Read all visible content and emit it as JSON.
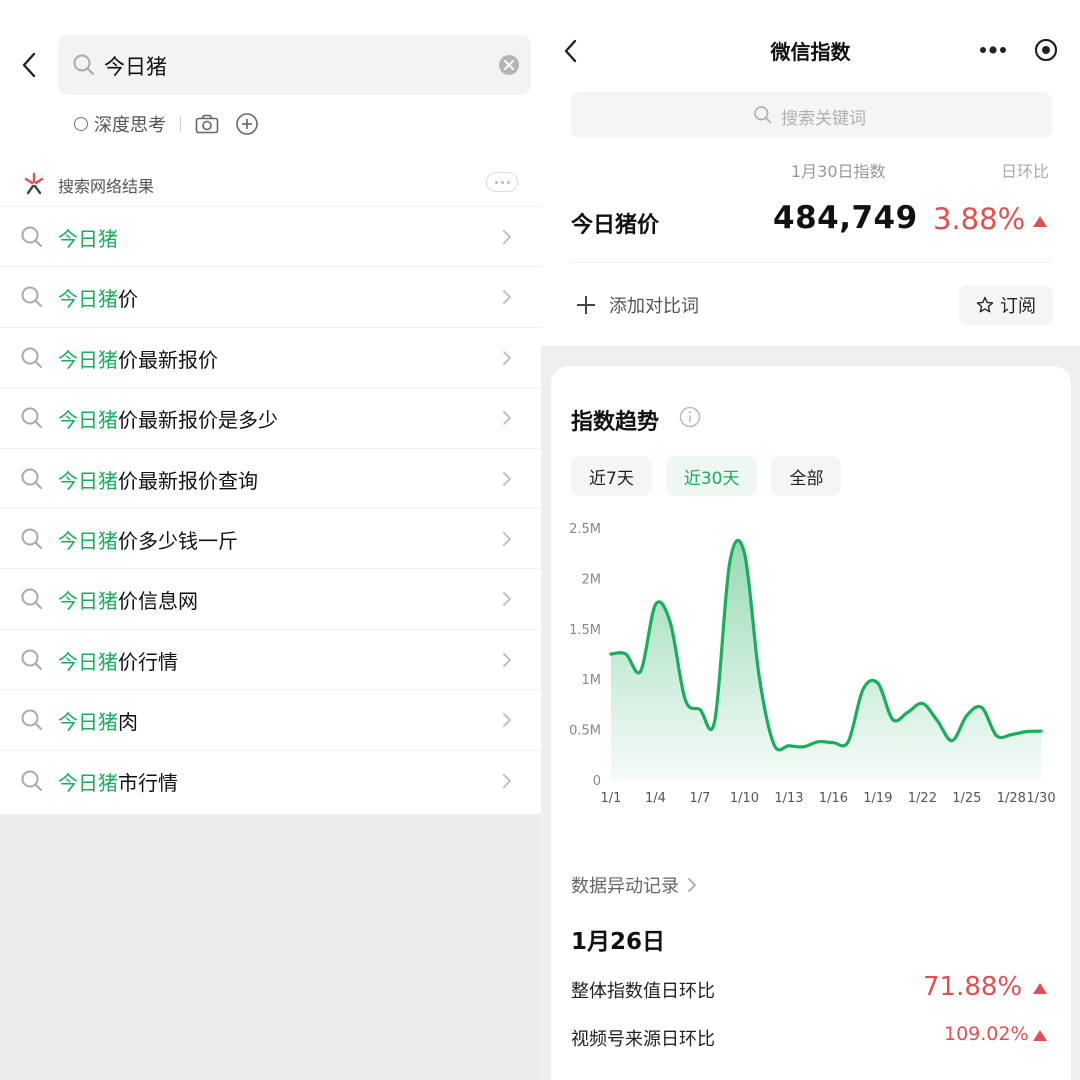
{
  "left": {
    "search_query": "今日猪",
    "deep_think_label": "深度思考",
    "web_results_label": "搜索网络结果",
    "highlight": "今日猪",
    "suggestions": [
      {
        "hl": "今日猪",
        "rest": ""
      },
      {
        "hl": "今日猪",
        "rest": "价"
      },
      {
        "hl": "今日猪",
        "rest": "价最新报价"
      },
      {
        "hl": "今日猪",
        "rest": "价最新报价是多少"
      },
      {
        "hl": "今日猪",
        "rest": "价最新报价查询"
      },
      {
        "hl": "今日猪",
        "rest": "价多少钱一斤"
      },
      {
        "hl": "今日猪",
        "rest": "价信息网"
      },
      {
        "hl": "今日猪",
        "rest": "价行情"
      },
      {
        "hl": "今日猪",
        "rest": "肉"
      },
      {
        "hl": "今日猪",
        "rest": "市行情"
      }
    ]
  },
  "right": {
    "title": "微信指数",
    "search_placeholder": "搜索关键词",
    "index_header": "1月30日指数",
    "dod_header": "日环比",
    "term": "今日猪价",
    "index_value": "484,749",
    "index_change": "3.88%",
    "add_compare": "添加对比词",
    "subscribe": "订阅",
    "trend_title": "指数趋势",
    "tabs": [
      "近7天",
      "近30天",
      "全部"
    ],
    "active_tab": 1,
    "anomaly_link": "数据异动记录",
    "anomaly_date": "1月26日",
    "rows": [
      {
        "label": "整体指数值日环比",
        "value": "71.88%"
      },
      {
        "label": "视频号来源日环比",
        "value": "109.02%"
      }
    ]
  },
  "colors": {
    "green": "#1aad5b",
    "red": "#e05050"
  },
  "chart_data": {
    "type": "area",
    "x": [
      "1/1",
      "1/2",
      "1/3",
      "1/4",
      "1/5",
      "1/6",
      "1/7",
      "1/8",
      "1/9",
      "1/10",
      "1/11",
      "1/12",
      "1/13",
      "1/14",
      "1/15",
      "1/16",
      "1/17",
      "1/18",
      "1/19",
      "1/20",
      "1/21",
      "1/22",
      "1/23",
      "1/24",
      "1/25",
      "1/26",
      "1/27",
      "1/28",
      "1/29",
      "1/30"
    ],
    "values": [
      1250000,
      1250000,
      1080000,
      1740000,
      1560000,
      800000,
      700000,
      590000,
      2150000,
      2250000,
      1020000,
      350000,
      340000,
      330000,
      380000,
      370000,
      380000,
      900000,
      960000,
      600000,
      670000,
      760000,
      590000,
      390000,
      640000,
      720000,
      440000,
      450000,
      480000,
      484749
    ],
    "xticks": [
      "1/1",
      "1/4",
      "1/7",
      "1/10",
      "1/13",
      "1/16",
      "1/19",
      "1/22",
      "1/25",
      "1/28",
      "1/30"
    ],
    "yticks": [
      "0",
      "0.5M",
      "1M",
      "1.5M",
      "2M",
      "2.5M"
    ],
    "ylim": [
      0,
      2500000
    ]
  }
}
